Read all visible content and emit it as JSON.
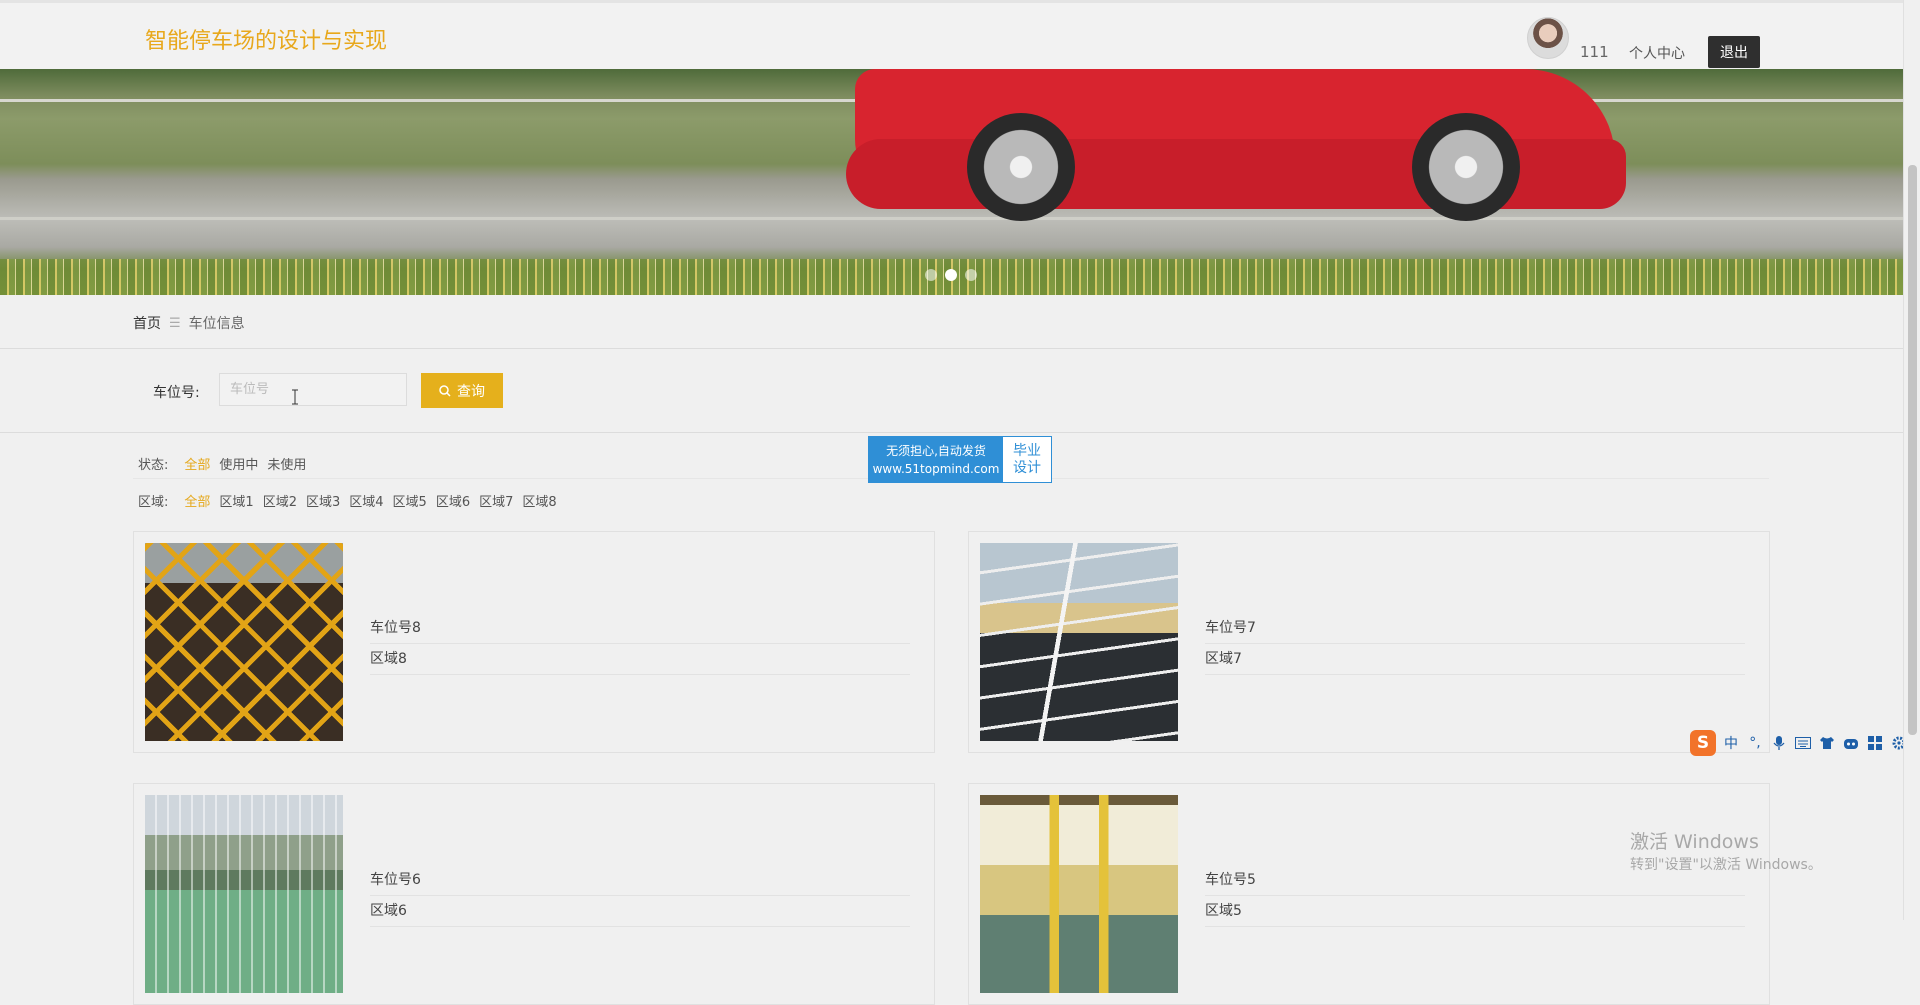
{
  "header": {
    "site_title": "智能停车场的设计与实现",
    "username": "111",
    "personal_center": "个人中心",
    "logout": "退出"
  },
  "banner": {
    "slide_count": 3,
    "active_slide": 2
  },
  "breadcrumb": {
    "home": "首页",
    "separator": "☰",
    "current": "车位信息"
  },
  "search": {
    "label": "车位号:",
    "placeholder": "车位号",
    "value": "",
    "button_label": "查询"
  },
  "filters": {
    "status": {
      "label": "状态:",
      "options": [
        "全部",
        "使用中",
        "未使用"
      ],
      "active": "全部"
    },
    "region": {
      "label": "区域:",
      "options": [
        "全部",
        "区域1",
        "区域2",
        "区域3",
        "区域4",
        "区域5",
        "区域6",
        "区域7",
        "区域8"
      ],
      "active": "全部"
    }
  },
  "ad": {
    "line1": "无须担心,自动发货",
    "line2": "www.51topmind.com",
    "right1": "毕业",
    "right2": "设计"
  },
  "cards": [
    {
      "number": "车位号8",
      "region": "区域8",
      "image": "yellow-grid-parking"
    },
    {
      "number": "车位号7",
      "region": "区域7",
      "image": "street-parking-white-lines"
    },
    {
      "number": "车位号6",
      "region": "区域6",
      "image": "green-grass-parking"
    },
    {
      "number": "车位号5",
      "region": "区域5",
      "image": "underground-garage"
    }
  ],
  "ime": {
    "items": [
      "中",
      "°,",
      "mic-icon",
      "keyboard-icon",
      "shirt-icon",
      "robot-icon",
      "grid-icon",
      "gear-icon"
    ]
  },
  "watermark": {
    "line1": "激活 Windows",
    "line2": "转到\"设置\"以激活 Windows。"
  },
  "colors": {
    "accent": "#e5b01c",
    "title": "#e8a81c",
    "logout_bg": "#2f2f2f"
  }
}
